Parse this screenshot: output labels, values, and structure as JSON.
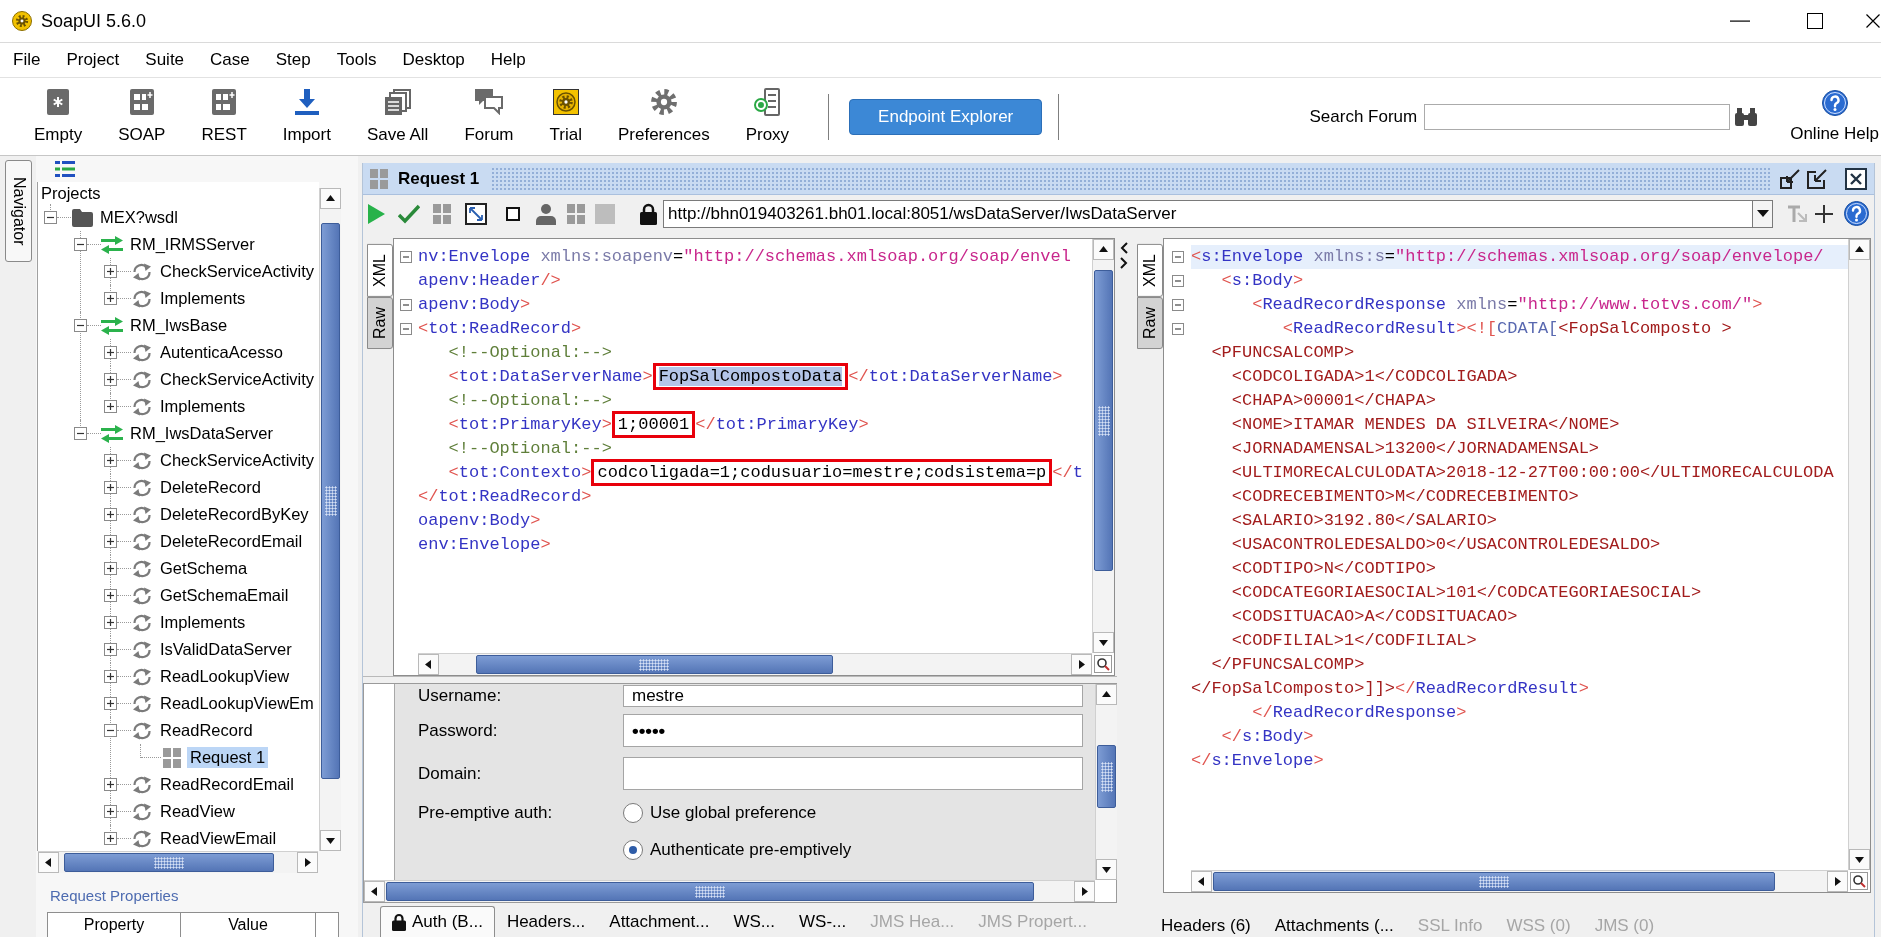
{
  "window": {
    "title": "SoapUI 5.6.0"
  },
  "menu": [
    "File",
    "Project",
    "Suite",
    "Case",
    "Step",
    "Tools",
    "Desktop",
    "Help"
  ],
  "toolbar": {
    "buttons": [
      {
        "kind": "empty",
        "label": "Empty"
      },
      {
        "kind": "soap",
        "label": "SOAP"
      },
      {
        "kind": "rest",
        "label": "REST"
      },
      {
        "kind": "import",
        "label": "Import"
      },
      {
        "kind": "saveall",
        "label": "Save All"
      },
      {
        "kind": "forum",
        "label": "Forum"
      },
      {
        "kind": "trial",
        "label": "Trial"
      },
      {
        "kind": "preferences",
        "label": "Preferences"
      },
      {
        "kind": "proxy",
        "label": "Proxy"
      }
    ],
    "endpoint_explorer": "Endpoint Explorer",
    "search_label": "Search Forum",
    "online_help": "Online Help"
  },
  "navigator": {
    "tab": "Navigator",
    "tree": {
      "label": "Projects",
      "selected": false,
      "children": [
        {
          "kind": "project",
          "label": "MEX?wsdl",
          "expanded": true,
          "selected": false,
          "children": [
            {
              "kind": "interface",
              "label": "RM_IRMSServer",
              "expanded": true,
              "selected": false,
              "children": [
                {
                  "kind": "operation",
                  "label": "CheckServiceActivity",
                  "expanded": false,
                  "selected": false
                },
                {
                  "kind": "operation",
                  "label": "Implements",
                  "expanded": false,
                  "selected": false
                }
              ]
            },
            {
              "kind": "interface",
              "label": "RM_IwsBase",
              "expanded": true,
              "selected": false,
              "children": [
                {
                  "kind": "operation",
                  "label": "AutenticaAcesso",
                  "expanded": false,
                  "selected": false
                },
                {
                  "kind": "operation",
                  "label": "CheckServiceActivity",
                  "expanded": false,
                  "selected": false
                },
                {
                  "kind": "operation",
                  "label": "Implements",
                  "expanded": false,
                  "selected": false
                }
              ]
            },
            {
              "kind": "interface",
              "label": "RM_IwsDataServer",
              "expanded": true,
              "selected": false,
              "children": [
                {
                  "kind": "operation",
                  "label": "CheckServiceActivity",
                  "expanded": false,
                  "selected": false
                },
                {
                  "kind": "operation",
                  "label": "DeleteRecord",
                  "expanded": false,
                  "selected": false
                },
                {
                  "kind": "operation",
                  "label": "DeleteRecordByKey",
                  "expanded": false,
                  "selected": false
                },
                {
                  "kind": "operation",
                  "label": "DeleteRecordEmail",
                  "expanded": false,
                  "selected": false
                },
                {
                  "kind": "operation",
                  "label": "GetSchema",
                  "expanded": false,
                  "selected": false
                },
                {
                  "kind": "operation",
                  "label": "GetSchemaEmail",
                  "expanded": false,
                  "selected": false
                },
                {
                  "kind": "operation",
                  "label": "Implements",
                  "expanded": false,
                  "selected": false
                },
                {
                  "kind": "operation",
                  "label": "IsValidDataServer",
                  "expanded": false,
                  "selected": false
                },
                {
                  "kind": "operation",
                  "label": "ReadLookupView",
                  "expanded": false,
                  "selected": false
                },
                {
                  "kind": "operation",
                  "label": "ReadLookupViewEm",
                  "expanded": false,
                  "selected": false
                },
                {
                  "kind": "operation",
                  "label": "ReadRecord",
                  "expanded": true,
                  "selected": false,
                  "children": [
                    {
                      "kind": "request",
                      "label": "Request 1",
                      "selected": true
                    }
                  ]
                },
                {
                  "kind": "operation",
                  "label": "ReadRecordEmail",
                  "expanded": false,
                  "selected": false
                },
                {
                  "kind": "operation",
                  "label": "ReadView",
                  "expanded": false,
                  "selected": false
                },
                {
                  "kind": "operation",
                  "label": "ReadViewEmail",
                  "expanded": false,
                  "selected": false
                }
              ]
            }
          ]
        }
      ]
    },
    "properties": {
      "title": "Request Properties",
      "columns": [
        "Property",
        "Value"
      ]
    }
  },
  "request_window": {
    "title": "Request 1",
    "endpoint": "http://bhn019403261.bh01.local:8051/wsDataServer/IwsDataServer",
    "request": {
      "tabs": [
        {
          "label": "XML",
          "selected": true
        },
        {
          "label": "Raw",
          "selected": false
        }
      ],
      "lines": [
        {
          "fold": true,
          "segments": [
            {
              "kind": "tag",
              "text": "nv:Envelope"
            },
            {
              "kind": "attr",
              "text": " xmlns:soapenv"
            },
            {
              "kind": "punct",
              "text": "="
            },
            {
              "kind": "string",
              "text": "\"http://schemas.xmlsoap.org/soap/envel"
            }
          ]
        },
        {
          "fold": false,
          "segments": [
            {
              "kind": "tag",
              "text": "apenv:Header"
            },
            {
              "kind": "bracket",
              "text": "/>"
            }
          ]
        },
        {
          "fold": true,
          "segments": [
            {
              "kind": "tag",
              "text": "apenv:Body"
            },
            {
              "kind": "bracket",
              "text": ">"
            }
          ]
        },
        {
          "fold": true,
          "segments": [
            {
              "kind": "bracket",
              "text": "<"
            },
            {
              "kind": "tag",
              "text": "tot:ReadRecord"
            },
            {
              "kind": "bracket",
              "text": ">"
            }
          ]
        },
        {
          "fold": false,
          "segments": [
            {
              "kind": "comment",
              "text": "   <!--Optional:-->"
            }
          ]
        },
        {
          "fold": false,
          "segments": [
            {
              "kind": "bracket",
              "text": "   <"
            },
            {
              "kind": "tag",
              "text": "tot:DataServerName"
            },
            {
              "kind": "bracket",
              "text": ">"
            },
            {
              "kind": "boxed",
              "text": "FopSalCompostoData",
              "selected": true
            },
            {
              "kind": "bracket",
              "text": "</"
            },
            {
              "kind": "tag",
              "text": "tot:DataServerName"
            },
            {
              "kind": "bracket",
              "text": ">"
            }
          ]
        },
        {
          "fold": false,
          "segments": [
            {
              "kind": "comment",
              "text": "   <!--Optional:-->"
            }
          ]
        },
        {
          "fold": false,
          "segments": [
            {
              "kind": "bracket",
              "text": "   <"
            },
            {
              "kind": "tag",
              "text": "tot:PrimaryKey"
            },
            {
              "kind": "bracket",
              "text": ">"
            },
            {
              "kind": "boxed",
              "text": "1;00001",
              "selected": false
            },
            {
              "kind": "bracket",
              "text": "</"
            },
            {
              "kind": "tag",
              "text": "tot:PrimaryKey"
            },
            {
              "kind": "bracket",
              "text": ">"
            }
          ]
        },
        {
          "fold": false,
          "segments": [
            {
              "kind": "comment",
              "text": "   <!--Optional:-->"
            }
          ]
        },
        {
          "fold": false,
          "segments": [
            {
              "kind": "bracket",
              "text": "   <"
            },
            {
              "kind": "tag",
              "text": "tot:Contexto"
            },
            {
              "kind": "bracket",
              "text": ">"
            },
            {
              "kind": "boxed",
              "text": "codcoligada=1;codusuario=mestre;codsistema=p",
              "selected": false
            },
            {
              "kind": "bracket",
              "text": "</"
            },
            {
              "kind": "tag",
              "text": "t"
            }
          ]
        },
        {
          "fold": false,
          "segments": [
            {
              "kind": "bracket",
              "text": "</"
            },
            {
              "kind": "tag",
              "text": "tot:ReadRecord"
            },
            {
              "kind": "bracket",
              "text": ">"
            }
          ]
        },
        {
          "fold": false,
          "segments": [
            {
              "kind": "tag",
              "text": "oapenv:Body"
            },
            {
              "kind": "bracket",
              "text": ">"
            }
          ]
        },
        {
          "fold": false,
          "segments": [
            {
              "kind": "tag",
              "text": "env:Envelope"
            },
            {
              "kind": "bracket",
              "text": ">"
            }
          ]
        }
      ]
    },
    "auth": {
      "fields": [
        {
          "kind": "text",
          "label": "Username:",
          "value": "mestre"
        },
        {
          "kind": "password",
          "label": "Password:",
          "value": "•••••"
        },
        {
          "kind": "text",
          "label": "Domain:"
        }
      ],
      "preemptive": {
        "label": "Pre-emptive auth:",
        "options": [
          {
            "label": "Use global preference",
            "selected": false
          },
          {
            "label": "Authenticate pre-emptively",
            "selected": true
          }
        ]
      }
    },
    "request_tabs": [
      {
        "kind": "auth",
        "label": "Auth (B...",
        "selected": true,
        "disabled": false
      },
      {
        "kind": "plain",
        "label": "Headers...",
        "selected": false,
        "disabled": false
      },
      {
        "kind": "plain",
        "label": "Attachment...",
        "selected": false,
        "disabled": false
      },
      {
        "kind": "plain",
        "label": "WS...",
        "selected": false,
        "disabled": false
      },
      {
        "kind": "plain",
        "label": "WS-...",
        "selected": false,
        "disabled": false
      },
      {
        "kind": "plain",
        "label": "JMS Hea...",
        "selected": false,
        "disabled": true
      },
      {
        "kind": "plain",
        "label": "JMS Propert...",
        "selected": false,
        "disabled": true
      }
    ],
    "response": {
      "tabs": [
        {
          "label": "XML",
          "selected": true
        },
        {
          "label": "Raw",
          "selected": false
        }
      ],
      "lines": [
        {
          "fold": true,
          "current": true,
          "segments": [
            {
              "kind": "bracket",
              "text": "<"
            },
            {
              "kind": "tag",
              "text": "s:Envelope"
            },
            {
              "kind": "attr",
              "text": " xmlns:s"
            },
            {
              "kind": "punct",
              "text": "="
            },
            {
              "kind": "string",
              "text": "\"http://schemas.xmlsoap.org/soap/envelope/"
            }
          ]
        },
        {
          "fold": true,
          "current": false,
          "segments": [
            {
              "kind": "bracket",
              "text": "   <"
            },
            {
              "kind": "tag",
              "text": "s:Body"
            },
            {
              "kind": "bracket",
              "text": ">"
            }
          ]
        },
        {
          "fold": true,
          "current": false,
          "segments": [
            {
              "kind": "bracket",
              "text": "      <"
            },
            {
              "kind": "tag",
              "text": "ReadRecordResponse"
            },
            {
              "kind": "attr",
              "text": " xmlns"
            },
            {
              "kind": "punct",
              "text": "="
            },
            {
              "kind": "string",
              "text": "\"http://www.totvs.com/\""
            },
            {
              "kind": "bracket",
              "text": ">"
            }
          ]
        },
        {
          "fold": true,
          "current": false,
          "segments": [
            {
              "kind": "bracket",
              "text": "         <"
            },
            {
              "kind": "tag",
              "text": "ReadRecordResult"
            },
            {
              "kind": "bracket",
              "text": "><!["
            },
            {
              "kind": "keyword",
              "text": "CDATA["
            },
            {
              "kind": "cdata",
              "text": "<FopSalComposto >"
            }
          ]
        },
        {
          "fold": false,
          "current": false,
          "segments": [
            {
              "kind": "cdata",
              "text": "  <PFUNCSALCOMP>"
            }
          ]
        },
        {
          "fold": false,
          "current": false,
          "segments": [
            {
              "kind": "cdata",
              "text": "    <CODCOLIGADA>1</CODCOLIGADA>"
            }
          ]
        },
        {
          "fold": false,
          "current": false,
          "segments": [
            {
              "kind": "cdata",
              "text": "    <CHAPA>00001</CHAPA>"
            }
          ]
        },
        {
          "fold": false,
          "current": false,
          "segments": [
            {
              "kind": "cdata",
              "text": "    <NOME>ITAMAR MENDES DA SILVEIRA</NOME>"
            }
          ]
        },
        {
          "fold": false,
          "current": false,
          "segments": [
            {
              "kind": "cdata",
              "text": "    <JORNADAMENSAL>13200</JORNADAMENSAL>"
            }
          ]
        },
        {
          "fold": false,
          "current": false,
          "segments": [
            {
              "kind": "cdata",
              "text": "    <ULTIMORECALCULODATA>2018-12-27T00:00:00</ULTIMORECALCULODA"
            }
          ]
        },
        {
          "fold": false,
          "current": false,
          "segments": [
            {
              "kind": "cdata",
              "text": "    <CODRECEBIMENTO>M</CODRECEBIMENTO>"
            }
          ]
        },
        {
          "fold": false,
          "current": false,
          "segments": [
            {
              "kind": "cdata",
              "text": "    <SALARIO>3192.80</SALARIO>"
            }
          ]
        },
        {
          "fold": false,
          "current": false,
          "segments": [
            {
              "kind": "cdata",
              "text": "    <USACONTROLEDESALDO>0</USACONTROLEDESALDO>"
            }
          ]
        },
        {
          "fold": false,
          "current": false,
          "segments": [
            {
              "kind": "cdata",
              "text": "    <CODTIPO>N</CODTIPO>"
            }
          ]
        },
        {
          "fold": false,
          "current": false,
          "segments": [
            {
              "kind": "cdata",
              "text": "    <CODCATEGORIAESOCIAL>101</CODCATEGORIAESOCIAL>"
            }
          ]
        },
        {
          "fold": false,
          "current": false,
          "segments": [
            {
              "kind": "cdata",
              "text": "    <CODSITUACAO>A</CODSITUACAO>"
            }
          ]
        },
        {
          "fold": false,
          "current": false,
          "segments": [
            {
              "kind": "cdata",
              "text": "    <CODFILIAL>1</CODFILIAL>"
            }
          ]
        },
        {
          "fold": false,
          "current": false,
          "segments": [
            {
              "kind": "cdata",
              "text": "  </PFUNCSALCOMP>"
            }
          ]
        },
        {
          "fold": false,
          "current": false,
          "segments": [
            {
              "kind": "cdata",
              "text": "</FopSalComposto>]]>"
            },
            {
              "kind": "bracket",
              "text": "</"
            },
            {
              "kind": "tag",
              "text": "ReadRecordResult"
            },
            {
              "kind": "bracket",
              "text": ">"
            }
          ]
        },
        {
          "fold": false,
          "current": false,
          "segments": [
            {
              "kind": "bracket",
              "text": "      </"
            },
            {
              "kind": "tag",
              "text": "ReadRecordResponse"
            },
            {
              "kind": "bracket",
              "text": ">"
            }
          ]
        },
        {
          "fold": false,
          "current": false,
          "segments": [
            {
              "kind": "bracket",
              "text": "   </"
            },
            {
              "kind": "tag",
              "text": "s:Body"
            },
            {
              "kind": "bracket",
              "text": ">"
            }
          ]
        },
        {
          "fold": false,
          "current": false,
          "segments": [
            {
              "kind": "bracket",
              "text": "</"
            },
            {
              "kind": "tag",
              "text": "s:Envelope"
            },
            {
              "kind": "bracket",
              "text": ">"
            }
          ]
        }
      ]
    },
    "response_tabs": [
      {
        "label": "Headers (6)",
        "selected": false,
        "disabled": false
      },
      {
        "label": "Attachments (...",
        "selected": false,
        "disabled": false
      },
      {
        "label": "SSL Info",
        "selected": false,
        "disabled": true
      },
      {
        "label": "WSS (0)",
        "selected": false,
        "disabled": true
      },
      {
        "label": "JMS (0)",
        "selected": false,
        "disabled": true
      }
    ]
  }
}
